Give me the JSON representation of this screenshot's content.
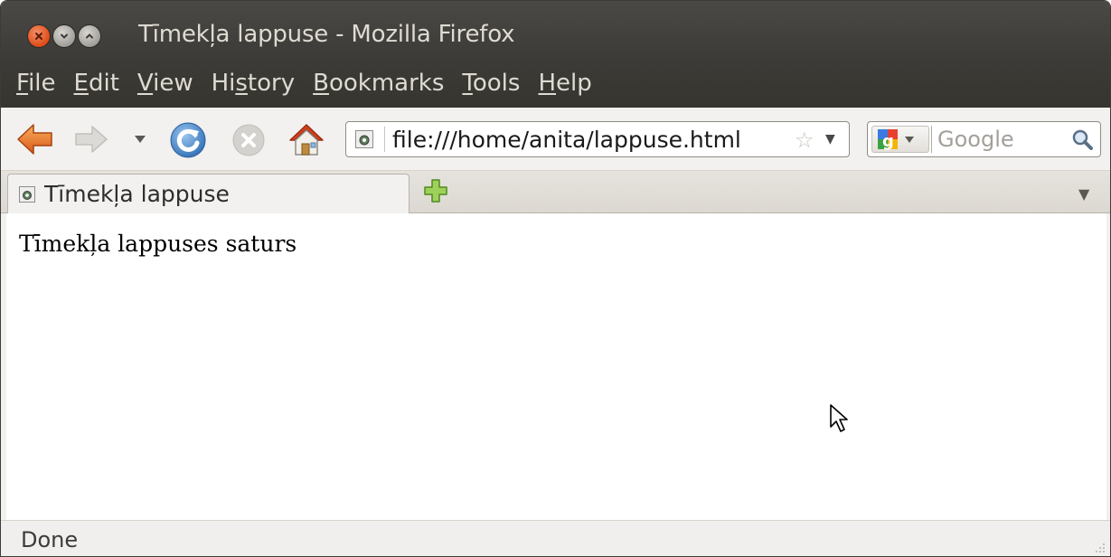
{
  "window": {
    "title": "Tīmekļa lappuse - Mozilla Firefox"
  },
  "menubar": {
    "items": [
      {
        "acc": "F",
        "rest": "ile"
      },
      {
        "acc": "E",
        "rest": "dit"
      },
      {
        "acc": "V",
        "rest": "iew"
      },
      {
        "pre": "Hi",
        "acc": "s",
        "rest": "tory"
      },
      {
        "acc": "B",
        "rest": "ookmarks"
      },
      {
        "acc": "T",
        "rest": "ools"
      },
      {
        "acc": "H",
        "rest": "elp"
      }
    ]
  },
  "navbar": {
    "url": "file:///home/anita/lappuse.html",
    "search_placeholder": "Google"
  },
  "tabs": [
    {
      "title": "Tīmekļa lappuse"
    }
  ],
  "content": {
    "text": "Tīmekļa lappuses saturs"
  },
  "status": {
    "text": "Done"
  },
  "colors": {
    "titlebar": "#3c3b37",
    "accent_close": "#df4a16",
    "text_light": "#dfdbd2"
  }
}
